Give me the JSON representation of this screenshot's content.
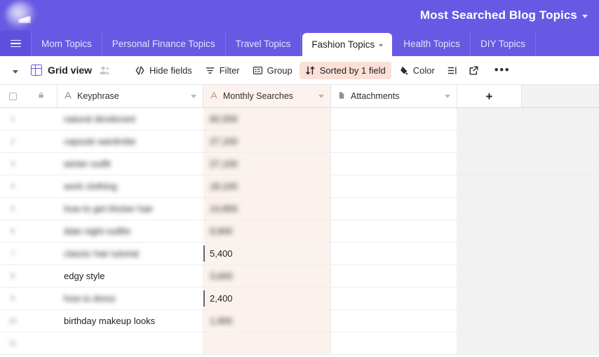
{
  "header": {
    "base_title": "Most Searched Blog Topics",
    "title_caret_icon": "chevron-down-icon",
    "logo_icon": "airtable-logo-icon"
  },
  "tabs": {
    "menu_icon": "hamburger-menu-icon",
    "items": [
      {
        "label": "Mom Topics",
        "active": false
      },
      {
        "label": "Personal Finance Topics",
        "active": false
      },
      {
        "label": "Travel Topics",
        "active": false
      },
      {
        "label": "Fashion Topics",
        "active": true
      },
      {
        "label": "Health Topics",
        "active": false
      },
      {
        "label": "DIY Topics",
        "active": false
      }
    ]
  },
  "toolbar": {
    "view_name": "Grid view",
    "view_icon": "grid-view-icon",
    "collaborators_icon": "people-icon",
    "view_caret_icon": "chevron-down-icon",
    "buttons": [
      {
        "label": "Hide fields",
        "icon": "hide-fields-icon",
        "active": false
      },
      {
        "label": "Filter",
        "icon": "filter-icon",
        "active": false
      },
      {
        "label": "Group",
        "icon": "group-icon",
        "active": false
      },
      {
        "label": "Sorted by 1 field",
        "icon": "sort-icon",
        "active": true
      },
      {
        "label": "Color",
        "icon": "color-palette-icon",
        "active": false
      }
    ],
    "row_height_icon": "row-height-icon",
    "share_icon": "share-view-icon",
    "more_icon": "more-options-icon",
    "sorted_badge_color": "#FAE0D6"
  },
  "grid": {
    "select_all_icon": "checkbox-icon",
    "lock_icon": "lock-icon",
    "add_field_label": "+",
    "columns": [
      {
        "name": "Keyphrase",
        "type_icon": "text-field-icon",
        "caret_icon": "chevron-down-icon"
      },
      {
        "name": "Monthly Searches",
        "type_icon": "text-field-icon",
        "caret_icon": "chevron-down-icon"
      },
      {
        "name": "Attachments",
        "type_icon": "attachment-field-icon",
        "caret_icon": "chevron-down-icon"
      }
    ],
    "rows": [
      {
        "num": "1",
        "keyphrase": "natural deodorant",
        "searches": "60,500",
        "blurred": true,
        "searches_blurred": true,
        "marked": false
      },
      {
        "num": "2",
        "keyphrase": "capsule wardrobe",
        "searches": "27,100",
        "blurred": true,
        "searches_blurred": true,
        "marked": false
      },
      {
        "num": "3",
        "keyphrase": "winter outfit",
        "searches": "27,100",
        "blurred": true,
        "searches_blurred": true,
        "marked": false
      },
      {
        "num": "4",
        "keyphrase": "work clothing",
        "searches": "18,100",
        "blurred": true,
        "searches_blurred": true,
        "marked": false
      },
      {
        "num": "5",
        "keyphrase": "how to get thicker hair",
        "searches": "14,800",
        "blurred": true,
        "searches_blurred": true,
        "marked": false
      },
      {
        "num": "6",
        "keyphrase": "date night outfits",
        "searches": "9,900",
        "blurred": true,
        "searches_blurred": true,
        "marked": false
      },
      {
        "num": "7",
        "keyphrase": "classic hair tutorial",
        "searches": "5,400",
        "blurred": true,
        "searches_blurred": false,
        "marked": true
      },
      {
        "num": "8",
        "keyphrase": "edgy style",
        "searches": "3,600",
        "blurred": false,
        "searches_blurred": true,
        "marked": false
      },
      {
        "num": "9",
        "keyphrase": "how to dress",
        "searches": "2,400",
        "blurred": true,
        "searches_blurred": false,
        "marked": true
      },
      {
        "num": "10",
        "keyphrase": "birthday makeup looks",
        "searches": "1,900",
        "blurred": false,
        "searches_blurred": true,
        "marked": false
      },
      {
        "num": "11",
        "keyphrase": "",
        "searches": "",
        "blurred": true,
        "searches_blurred": true,
        "marked": false
      }
    ]
  },
  "colors": {
    "brand_purple": "#6759E3",
    "tab_active_bg": "#FFFFFF",
    "sorted_bg": "#FAE0D6",
    "monthly_col_bg": "#FBF2EE",
    "right_gutter_bg": "#F2F2F2"
  }
}
